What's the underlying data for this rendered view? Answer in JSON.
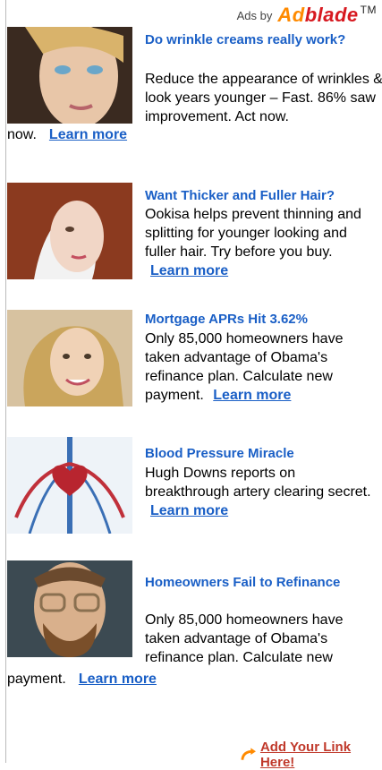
{
  "header": {
    "ads_by": "Ads by",
    "logo_ad": "Ad",
    "logo_blade": "blade",
    "logo_tm": "TM"
  },
  "ads": [
    {
      "title": "Do wrinkle creams really work?",
      "body": "Reduce the appearance of wrinkles & look years younger – Fast. 86% saw improvement. Act now.",
      "link": "Learn more"
    },
    {
      "title": "Want Thicker and Fuller Hair?",
      "body": "Ookisa helps prevent thinning and splitting for younger looking and fuller hair. Try before you buy.",
      "link": "Learn more"
    },
    {
      "title": "Mortgage APRs Hit 3.62%",
      "body": "Only 85,000 homeowners have taken advantage of Obama's refinance plan. Calculate new payment.",
      "link": "Learn more"
    },
    {
      "title": "Blood Pressure Miracle",
      "body": "Hugh Downs reports on breakthrough artery clearing secret.",
      "link": "Learn more"
    },
    {
      "title": "Homeowners Fail to Refinance",
      "body": "Only 85,000 homeowners have taken advantage of Obama's refinance plan. Calculate new payment.",
      "link": "Learn more"
    }
  ],
  "footer": {
    "add_link": "Add Your Link Here!"
  }
}
